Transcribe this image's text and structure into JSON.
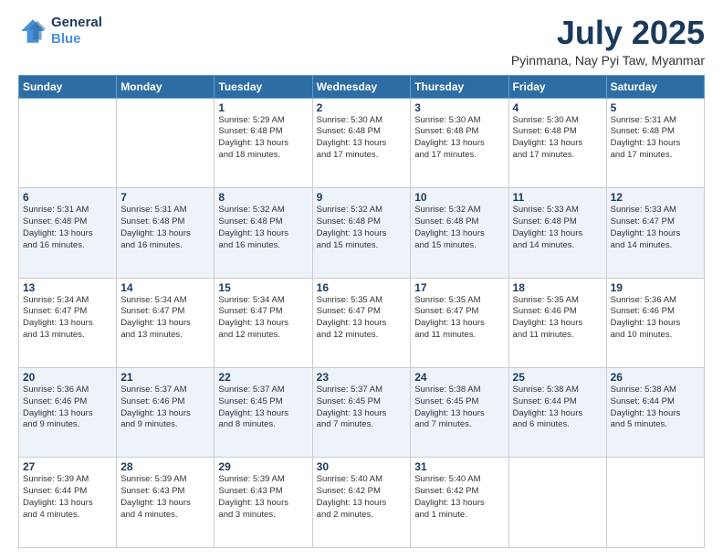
{
  "header": {
    "logo_line1": "General",
    "logo_line2": "Blue",
    "title": "July 2025",
    "subtitle": "Pyinmana, Nay Pyi Taw, Myanmar"
  },
  "calendar": {
    "days_of_week": [
      "Sunday",
      "Monday",
      "Tuesday",
      "Wednesday",
      "Thursday",
      "Friday",
      "Saturday"
    ],
    "weeks": [
      [
        {
          "day": "",
          "info": ""
        },
        {
          "day": "",
          "info": ""
        },
        {
          "day": "1",
          "info": "Sunrise: 5:29 AM\nSunset: 6:48 PM\nDaylight: 13 hours\nand 18 minutes."
        },
        {
          "day": "2",
          "info": "Sunrise: 5:30 AM\nSunset: 6:48 PM\nDaylight: 13 hours\nand 17 minutes."
        },
        {
          "day": "3",
          "info": "Sunrise: 5:30 AM\nSunset: 6:48 PM\nDaylight: 13 hours\nand 17 minutes."
        },
        {
          "day": "4",
          "info": "Sunrise: 5:30 AM\nSunset: 6:48 PM\nDaylight: 13 hours\nand 17 minutes."
        },
        {
          "day": "5",
          "info": "Sunrise: 5:31 AM\nSunset: 6:48 PM\nDaylight: 13 hours\nand 17 minutes."
        }
      ],
      [
        {
          "day": "6",
          "info": "Sunrise: 5:31 AM\nSunset: 6:48 PM\nDaylight: 13 hours\nand 16 minutes."
        },
        {
          "day": "7",
          "info": "Sunrise: 5:31 AM\nSunset: 6:48 PM\nDaylight: 13 hours\nand 16 minutes."
        },
        {
          "day": "8",
          "info": "Sunrise: 5:32 AM\nSunset: 6:48 PM\nDaylight: 13 hours\nand 16 minutes."
        },
        {
          "day": "9",
          "info": "Sunrise: 5:32 AM\nSunset: 6:48 PM\nDaylight: 13 hours\nand 15 minutes."
        },
        {
          "day": "10",
          "info": "Sunrise: 5:32 AM\nSunset: 6:48 PM\nDaylight: 13 hours\nand 15 minutes."
        },
        {
          "day": "11",
          "info": "Sunrise: 5:33 AM\nSunset: 6:48 PM\nDaylight: 13 hours\nand 14 minutes."
        },
        {
          "day": "12",
          "info": "Sunrise: 5:33 AM\nSunset: 6:47 PM\nDaylight: 13 hours\nand 14 minutes."
        }
      ],
      [
        {
          "day": "13",
          "info": "Sunrise: 5:34 AM\nSunset: 6:47 PM\nDaylight: 13 hours\nand 13 minutes."
        },
        {
          "day": "14",
          "info": "Sunrise: 5:34 AM\nSunset: 6:47 PM\nDaylight: 13 hours\nand 13 minutes."
        },
        {
          "day": "15",
          "info": "Sunrise: 5:34 AM\nSunset: 6:47 PM\nDaylight: 13 hours\nand 12 minutes."
        },
        {
          "day": "16",
          "info": "Sunrise: 5:35 AM\nSunset: 6:47 PM\nDaylight: 13 hours\nand 12 minutes."
        },
        {
          "day": "17",
          "info": "Sunrise: 5:35 AM\nSunset: 6:47 PM\nDaylight: 13 hours\nand 11 minutes."
        },
        {
          "day": "18",
          "info": "Sunrise: 5:35 AM\nSunset: 6:46 PM\nDaylight: 13 hours\nand 11 minutes."
        },
        {
          "day": "19",
          "info": "Sunrise: 5:36 AM\nSunset: 6:46 PM\nDaylight: 13 hours\nand 10 minutes."
        }
      ],
      [
        {
          "day": "20",
          "info": "Sunrise: 5:36 AM\nSunset: 6:46 PM\nDaylight: 13 hours\nand 9 minutes."
        },
        {
          "day": "21",
          "info": "Sunrise: 5:37 AM\nSunset: 6:46 PM\nDaylight: 13 hours\nand 9 minutes."
        },
        {
          "day": "22",
          "info": "Sunrise: 5:37 AM\nSunset: 6:45 PM\nDaylight: 13 hours\nand 8 minutes."
        },
        {
          "day": "23",
          "info": "Sunrise: 5:37 AM\nSunset: 6:45 PM\nDaylight: 13 hours\nand 7 minutes."
        },
        {
          "day": "24",
          "info": "Sunrise: 5:38 AM\nSunset: 6:45 PM\nDaylight: 13 hours\nand 7 minutes."
        },
        {
          "day": "25",
          "info": "Sunrise: 5:38 AM\nSunset: 6:44 PM\nDaylight: 13 hours\nand 6 minutes."
        },
        {
          "day": "26",
          "info": "Sunrise: 5:38 AM\nSunset: 6:44 PM\nDaylight: 13 hours\nand 5 minutes."
        }
      ],
      [
        {
          "day": "27",
          "info": "Sunrise: 5:39 AM\nSunset: 6:44 PM\nDaylight: 13 hours\nand 4 minutes."
        },
        {
          "day": "28",
          "info": "Sunrise: 5:39 AM\nSunset: 6:43 PM\nDaylight: 13 hours\nand 4 minutes."
        },
        {
          "day": "29",
          "info": "Sunrise: 5:39 AM\nSunset: 6:43 PM\nDaylight: 13 hours\nand 3 minutes."
        },
        {
          "day": "30",
          "info": "Sunrise: 5:40 AM\nSunset: 6:42 PM\nDaylight: 13 hours\nand 2 minutes."
        },
        {
          "day": "31",
          "info": "Sunrise: 5:40 AM\nSunset: 6:42 PM\nDaylight: 13 hours\nand 1 minute."
        },
        {
          "day": "",
          "info": ""
        },
        {
          "day": "",
          "info": ""
        }
      ]
    ]
  }
}
